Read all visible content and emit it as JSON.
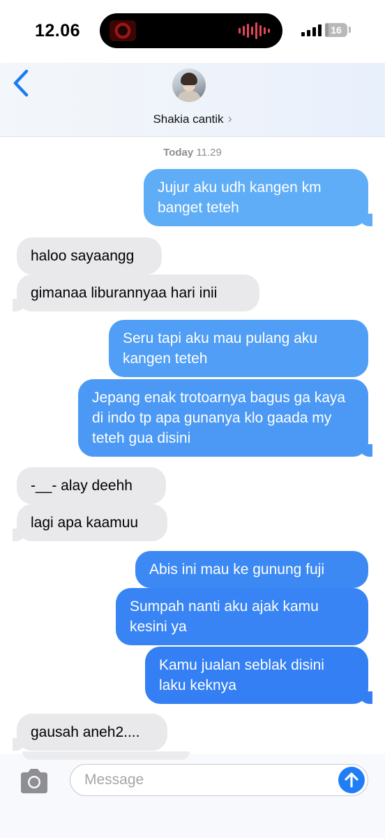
{
  "status_bar": {
    "time": "12.06",
    "battery_level": "16",
    "battery_fraction": 0.16
  },
  "header": {
    "contact_name": "Shakia cantik",
    "chevron": "›"
  },
  "thread": {
    "timestamp_day": "Today",
    "timestamp_time": "11.29",
    "colors": {
      "outgoing_light": "#5fadf6",
      "outgoing_dark": "#2e7af3",
      "incoming": "#e9e9eb"
    },
    "messages": [
      {
        "direction": "out",
        "text": "Jujur aku udh kangen km banget teteh"
      },
      {
        "direction": "in",
        "text": "haloo sayaangg"
      },
      {
        "direction": "in",
        "text": "gimanaa liburannyaa hari inii"
      },
      {
        "direction": "out",
        "text": "Seru tapi aku mau pulang aku kangen teteh"
      },
      {
        "direction": "out",
        "text": "Jepang enak trotoarnya bagus ga kaya di indo tp apa gunanya klo gaada my teteh gua disini"
      },
      {
        "direction": "in",
        "text": "-__- alay deehh"
      },
      {
        "direction": "in",
        "text": "lagi apa kaamuu"
      },
      {
        "direction": "out",
        "text": "Abis ini mau ke gunung fuji"
      },
      {
        "direction": "out",
        "text": "Sumpah nanti aku ajak kamu kesini ya"
      },
      {
        "direction": "out",
        "text": "Kamu jualan seblak disini laku keknya"
      },
      {
        "direction": "in",
        "text": "gausah aneh2...."
      }
    ]
  },
  "composer": {
    "placeholder": "Message",
    "icons": {
      "camera": "camera-icon",
      "send": "arrow-up-icon"
    }
  }
}
